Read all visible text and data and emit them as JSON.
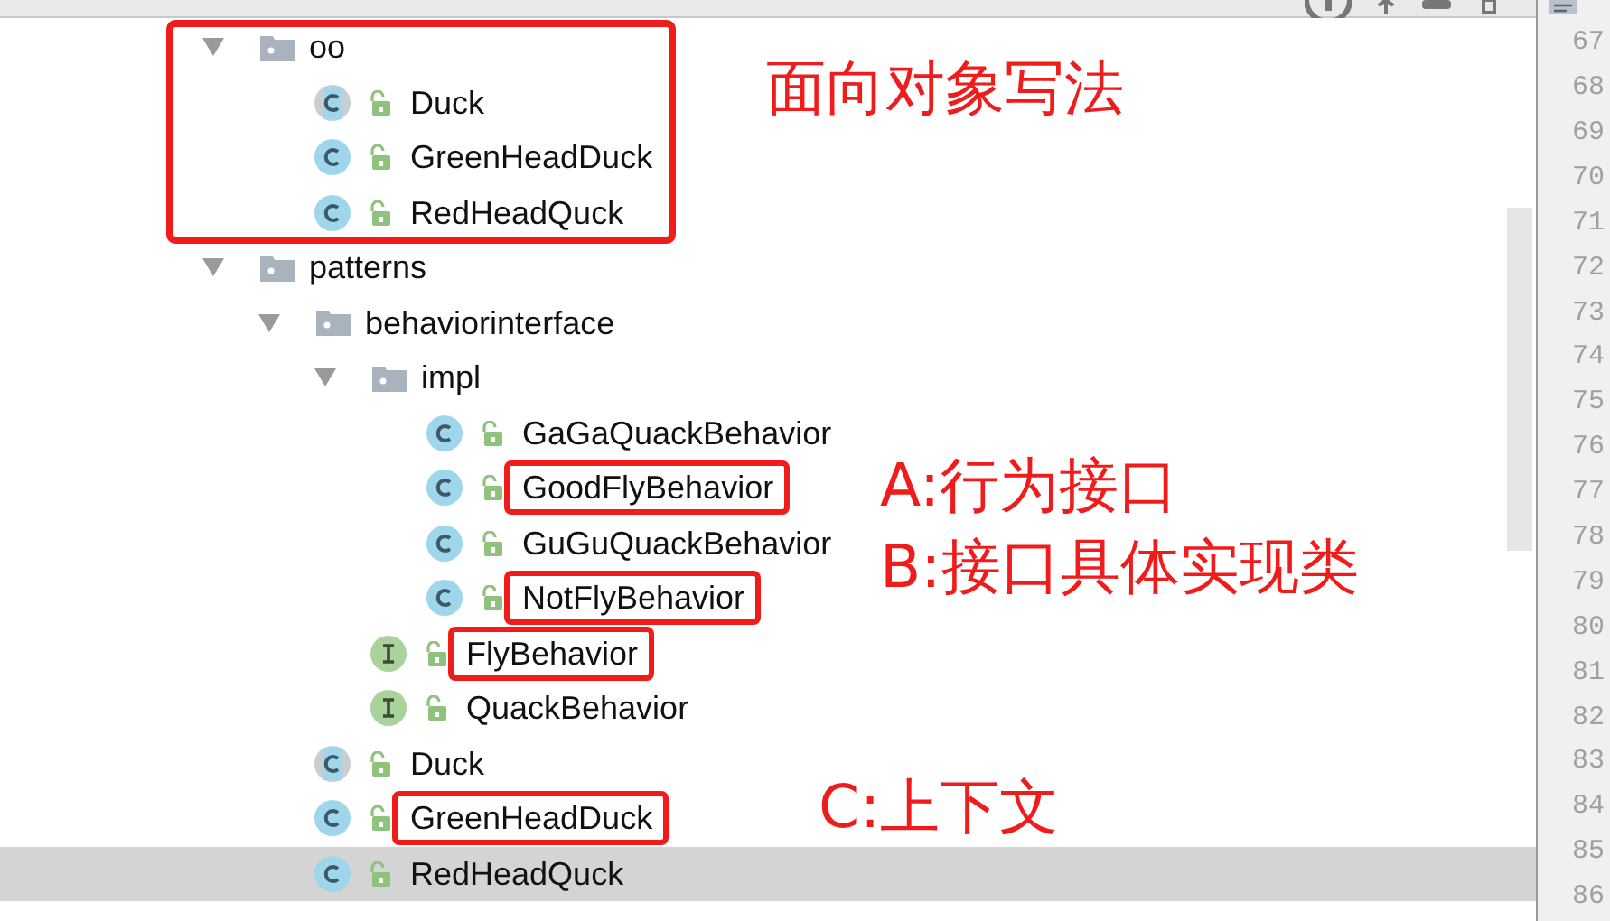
{
  "tree": [
    {
      "name": "oo",
      "kind": "folder",
      "expanded": true,
      "selected": false,
      "boxed": true,
      "children": [
        {
          "name": "Duck",
          "kind": "abstract",
          "selected": false,
          "boxed": false
        },
        {
          "name": "GreenHeadDuck",
          "kind": "class",
          "selected": false,
          "boxed": false
        },
        {
          "name": "RedHeadQuck",
          "kind": "class",
          "selected": false,
          "boxed": false
        }
      ]
    },
    {
      "name": "patterns",
      "kind": "folder",
      "expanded": true,
      "selected": false,
      "boxed": false,
      "children": [
        {
          "name": "behaviorinterface",
          "kind": "folder",
          "expanded": true,
          "selected": false,
          "boxed": false,
          "children": [
            {
              "name": "impl",
              "kind": "folder",
              "expanded": true,
              "selected": false,
              "boxed": false,
              "children": [
                {
                  "name": "GaGaQuackBehavior",
                  "kind": "class",
                  "selected": false,
                  "boxed": false
                },
                {
                  "name": "GoodFlyBehavior",
                  "kind": "class",
                  "selected": false,
                  "boxed": true
                },
                {
                  "name": "GuGuQuackBehavior",
                  "kind": "class",
                  "selected": false,
                  "boxed": false
                },
                {
                  "name": "NotFlyBehavior",
                  "kind": "class",
                  "selected": false,
                  "boxed": true
                }
              ]
            },
            {
              "name": "FlyBehavior",
              "kind": "interface",
              "selected": false,
              "boxed": true
            },
            {
              "name": "QuackBehavior",
              "kind": "interface",
              "selected": false,
              "boxed": false
            }
          ]
        },
        {
          "name": "Duck",
          "kind": "abstract",
          "selected": false,
          "boxed": false
        },
        {
          "name": "GreenHeadDuck",
          "kind": "class",
          "selected": false,
          "boxed": true
        },
        {
          "name": "RedHeadQuck",
          "kind": "class",
          "selected": true,
          "boxed": false
        }
      ]
    }
  ],
  "annotations": [
    "面向对象写法",
    "A:行为接口",
    "B:接口具体实现类",
    "C:上下文"
  ],
  "line_numbers": [
    "67",
    "68",
    "69",
    "70",
    "71",
    "72",
    "73",
    "74",
    "75",
    "76",
    "77",
    "78",
    "79",
    "80",
    "81",
    "82",
    "83",
    "84",
    "85",
    "86"
  ]
}
